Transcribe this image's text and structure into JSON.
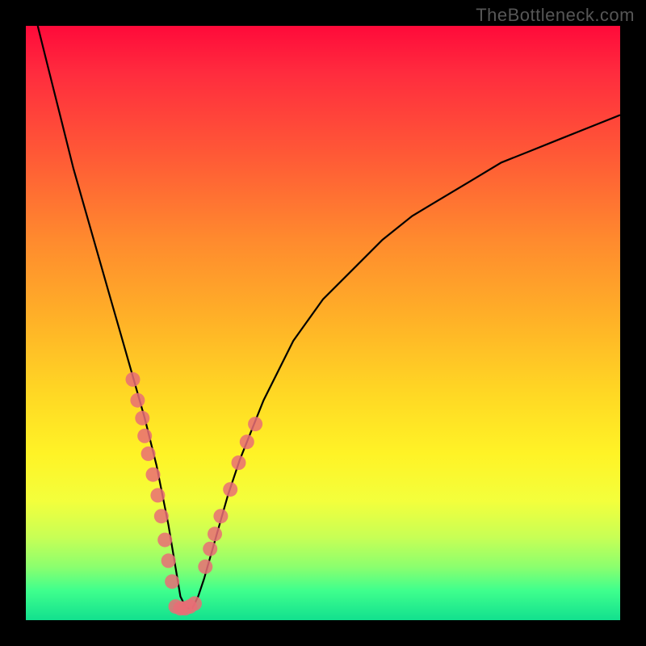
{
  "watermark": "TheBottleneck.com",
  "chart_data": {
    "type": "line",
    "title": "",
    "xlabel": "",
    "ylabel": "",
    "xlim": [
      0,
      100
    ],
    "ylim": [
      0,
      100
    ],
    "grid": false,
    "series": [
      {
        "name": "bottleneck-curve",
        "x": [
          2,
          4,
          6,
          8,
          10,
          12,
          14,
          16,
          18,
          20,
          22,
          24,
          25,
          26,
          27,
          28,
          29,
          30,
          32,
          34,
          36,
          40,
          45,
          50,
          55,
          60,
          65,
          70,
          75,
          80,
          85,
          90,
          95,
          100
        ],
        "y": [
          100,
          92,
          84,
          76,
          69,
          62,
          55,
          48,
          41,
          34,
          26,
          16,
          10,
          4,
          2,
          2,
          4,
          7,
          14,
          21,
          27,
          37,
          47,
          54,
          59,
          64,
          68,
          71,
          74,
          77,
          79,
          81,
          83,
          85
        ]
      },
      {
        "name": "left-dots",
        "type": "scatter",
        "x": [
          18.0,
          18.8,
          19.6,
          20.0,
          20.6,
          21.4,
          22.2,
          22.8,
          23.4,
          24.0,
          24.6
        ],
        "y": [
          40.5,
          37.0,
          34.0,
          31.0,
          28.0,
          24.5,
          21.0,
          17.5,
          13.5,
          10.0,
          6.5
        ]
      },
      {
        "name": "bottom-dots",
        "type": "scatter",
        "x": [
          25.2,
          26.0,
          26.8,
          27.6,
          28.4
        ],
        "y": [
          2.3,
          2.0,
          2.0,
          2.3,
          2.8
        ]
      },
      {
        "name": "right-dots",
        "type": "scatter",
        "x": [
          30.2,
          31.0,
          31.8,
          32.8,
          34.4,
          35.8,
          37.2,
          38.6
        ],
        "y": [
          9.0,
          12.0,
          14.5,
          17.5,
          22.0,
          26.5,
          30.0,
          33.0
        ]
      }
    ],
    "colors": {
      "curve": "#000000",
      "dots": "#e96d75"
    }
  }
}
